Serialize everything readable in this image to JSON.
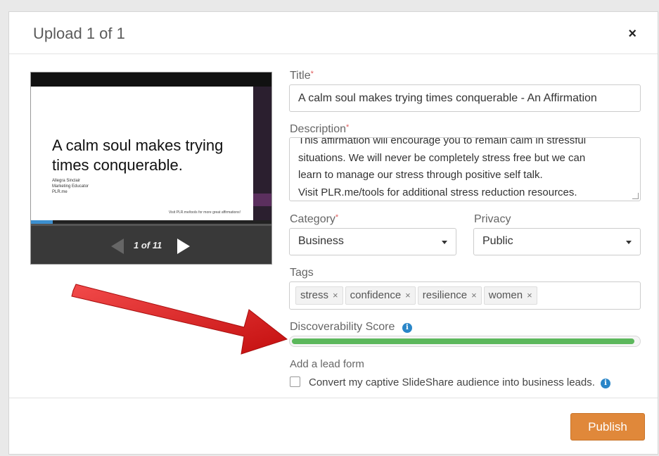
{
  "modal": {
    "title": "Upload 1 of 1",
    "close_label": "×"
  },
  "preview": {
    "slide_heading": "A calm soul makes trying times conquerable.",
    "slide_author": "Allegra Sinclair",
    "slide_role": "Marketing Educator",
    "slide_site": "PLR.me",
    "slide_footer": "Visit PLR.me/tools for more great affirmations!",
    "page_counter": "1 of 11",
    "progress": 0.09
  },
  "form": {
    "title_label": "Title",
    "required_mark": "*",
    "title_value": "A calm soul makes trying times conquerable - An Affirmation",
    "description_label": "Description",
    "description_lines": [
      "This affirmation will encourage you to remain calm in stressful",
      "situations. We will never be completely stress free but we can",
      "learn to manage our stress through positive self talk.",
      "Visit PLR.me/tools for additional stress reduction resources."
    ],
    "category_label": "Category",
    "category_value": "Business",
    "privacy_label": "Privacy",
    "privacy_value": "Public",
    "tags_label": "Tags",
    "tags": [
      "stress",
      "confidence",
      "resilience",
      "women"
    ],
    "tag_remove": "×",
    "score_label": "Discoverability Score",
    "score_fraction": 0.99,
    "info_glyph": "i",
    "lead_form_label": "Add a lead form",
    "lead_form_checkbox_label": "Convert my captive SlideShare audience into business leads."
  },
  "footer": {
    "publish_label": "Publish"
  },
  "colors": {
    "accent_orange": "#e0883a",
    "score_green": "#5cb85c",
    "info_blue": "#2a86c8",
    "annotation_red": "#e01b1b"
  },
  "icons": [
    "close-icon",
    "prev-arrow-icon",
    "next-arrow-icon",
    "chevron-down-icon",
    "info-icon",
    "remove-tag-icon",
    "annotation-arrow"
  ]
}
